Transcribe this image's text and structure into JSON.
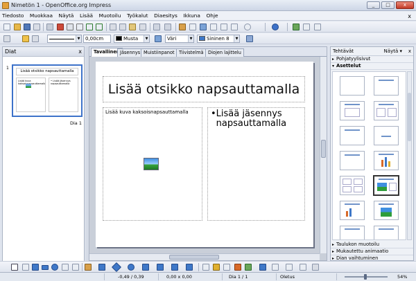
{
  "window": {
    "title": "Nimetön 1 - OpenOffice.org Impress",
    "btn_min": "_",
    "btn_max": "□",
    "btn_close": "x"
  },
  "menu": {
    "items": [
      "Tiedosto",
      "Muokkaa",
      "Näytä",
      "Lisää",
      "Muotoilu",
      "Työkalut",
      "Diaesitys",
      "Ikkuna",
      "Ohje"
    ],
    "close": "x"
  },
  "format_toolbar": {
    "line_width": "0,00cm",
    "line_color": "Musta",
    "area_style": "Väri",
    "area_color": "Sininen 8"
  },
  "colors": {
    "line_color": "#000000",
    "area_color": "#3f78c8",
    "accent": "#3d72c9"
  },
  "slides_panel": {
    "title": "Diat",
    "close": "x",
    "slide_label": "Dia 1",
    "slide_number": "1"
  },
  "thumbnail": {
    "title": "Lisää otsikko napsauttamalla",
    "left_caption": "Lisää kuva kaksoisnapsauttamalla",
    "right_caption": "• Lisää jäsennys napsauttamalla"
  },
  "tabs": [
    "Tavallinen",
    "Jäsennys",
    "Muistiinpanot",
    "Tiivistelmä",
    "Diojen lajittelu"
  ],
  "slide": {
    "title_placeholder": "Lisää otsikko napsauttamalla",
    "image_placeholder": "Lisää kuva kaksoisnapsauttamalla",
    "outline_placeholder": "Lisää jäsennys napsauttamalla",
    "bullet": "•"
  },
  "tasks_panel": {
    "title": "Tehtävät",
    "view_label": "Näytä ▾",
    "close": "x",
    "section_master": "Pohjatyylisivut",
    "section_layouts": "Asettelut",
    "section_table": "Taulukon muotoilu",
    "section_animation": "Mukautettu animaatio",
    "section_transition": "Dian vaihtuminen"
  },
  "status": {
    "position": "-0,49 / 0,39",
    "size": "0,00 x 0,00",
    "slide": "Dia 1 / 1",
    "layout": "Oletus",
    "zoom": "54%"
  }
}
